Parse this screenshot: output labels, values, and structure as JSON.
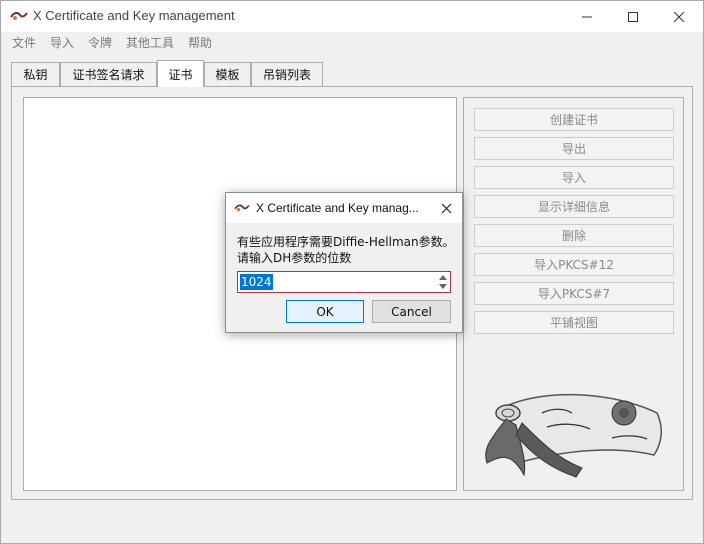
{
  "window": {
    "title": "X Certificate and Key management",
    "app_icon": "xca-scroll-icon",
    "controls": {
      "minimize": "minimize-icon",
      "maximize": "maximize-icon",
      "close": "close-icon"
    }
  },
  "menu": [
    "文件",
    "导入",
    "令牌",
    "其他工具",
    "帮助"
  ],
  "tabs": [
    {
      "label": "私钥",
      "active": false
    },
    {
      "label": "证书签名请求",
      "active": false
    },
    {
      "label": "证书",
      "active": true
    },
    {
      "label": "模板",
      "active": false
    },
    {
      "label": "吊销列表",
      "active": false
    }
  ],
  "side_buttons": [
    "创建证书",
    "导出",
    "导入",
    "显示详细信息",
    "删除",
    "导入PKCS#12",
    "导入PKCS#7",
    "平铺视图"
  ],
  "dialog": {
    "title": "X Certificate and Key manag...",
    "message_line1": "有些应用程序需要Diffie-Hellman参数。",
    "message_line2": "请输入DH参数的位数",
    "value": "1024",
    "ok_label": "OK",
    "cancel_label": "Cancel"
  },
  "colors": {
    "accent": "#0078d7",
    "input_border": "#b0304a",
    "disabled_text": "#8a8a8a"
  }
}
